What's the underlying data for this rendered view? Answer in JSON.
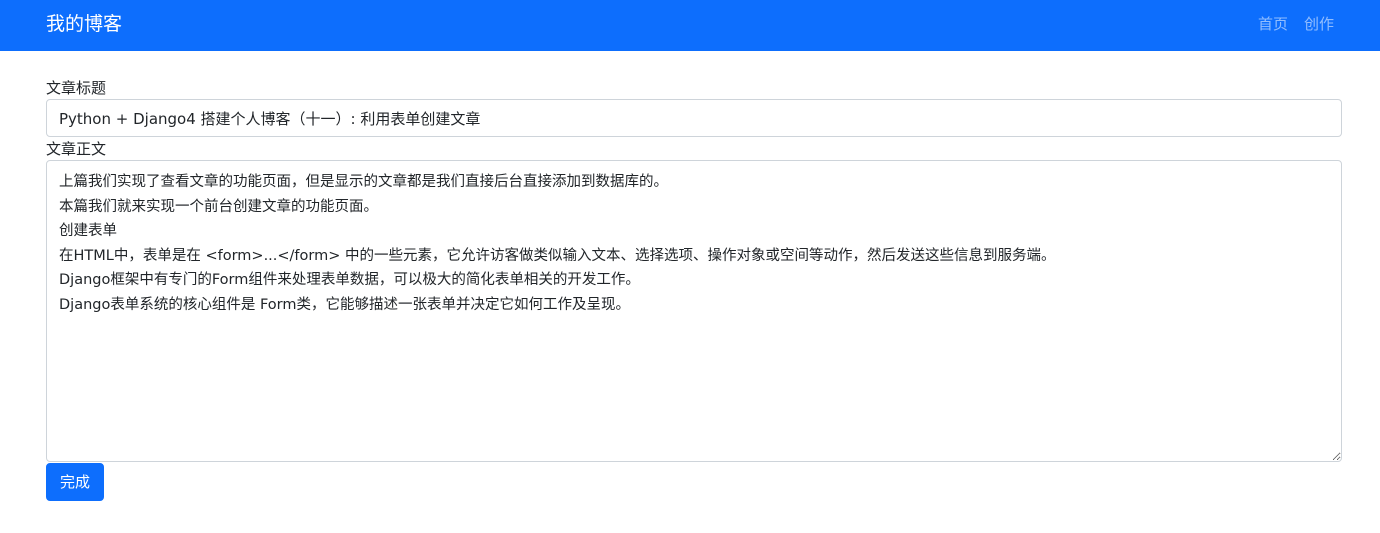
{
  "navbar": {
    "brand": "我的博客",
    "links": [
      {
        "label": "首页"
      },
      {
        "label": "创作"
      }
    ]
  },
  "form": {
    "title_label": "文章标题",
    "title_value": "Python + Django4 搭建个人博客（十一）: 利用表单创建文章",
    "body_label": "文章正文",
    "body_value": "上篇我们实现了查看文章的功能页面，但是显示的文章都是我们直接后台直接添加到数据库的。\n本篇我们就来实现一个前台创建文章的功能页面。\n创建表单\n在HTML中，表单是在 <form>...</form> 中的一些元素，它允许访客做类似输入文本、选择选项、操作对象或空间等动作，然后发送这些信息到服务端。\nDjango框架中有专门的Form组件来处理表单数据，可以极大的简化表单相关的开发工作。\nDjango表单系统的核心组件是 Form类，它能够描述一张表单并决定它如何工作及呈现。",
    "submit_label": "完成"
  },
  "colors": {
    "primary": "#0d6efd",
    "nav_link": "rgba(255,255,255,0.55)",
    "border": "#ced4da"
  }
}
